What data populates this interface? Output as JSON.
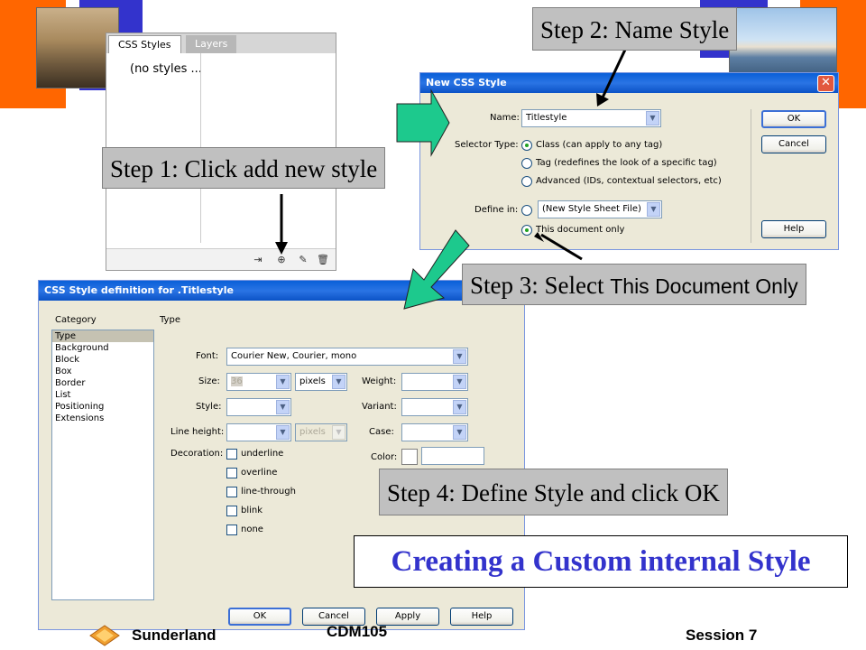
{
  "callouts": {
    "step1": "Step 1: Click add new style",
    "step2": "Step 2: Name Style",
    "step3_main": "Step 3: Select ",
    "step3_tail": "This Document Only",
    "step4": "Step 4: Define Style and click OK"
  },
  "banner": "Creating a Custom internal Style",
  "footer": {
    "left": "Sunderland",
    "center": "CDM105",
    "right": "Session 7"
  },
  "css_panel": {
    "tabs": [
      "CSS Styles",
      "Layers"
    ],
    "empty_text": "(no styles ...",
    "toolbar_icons": [
      "attach-style-sheet-icon",
      "new-css-style-icon",
      "edit-style-sheet-icon",
      "trash-icon"
    ]
  },
  "new_style_dialog": {
    "title": "New CSS Style",
    "name_label": "Name:",
    "name_value": "Titlestyle",
    "selector_label": "Selector Type:",
    "selector_options": [
      "Class (can apply to any tag)",
      "Tag (redefines the look of a specific tag)",
      "Advanced (IDs, contextual selectors, etc)"
    ],
    "define_label": "Define in:",
    "define_file": "(New Style Sheet File)",
    "define_this_doc": "This document only",
    "buttons": {
      "ok": "OK",
      "cancel": "Cancel",
      "help": "Help"
    }
  },
  "definition_dialog": {
    "title": "CSS Style definition for .Titlestyle",
    "category_label": "Category",
    "panel_label": "Type",
    "categories": [
      "Type",
      "Background",
      "Block",
      "Box",
      "Border",
      "List",
      "Positioning",
      "Extensions"
    ],
    "font_label": "Font:",
    "font_value": "Courier New, Courier, mono",
    "size_label": "Size:",
    "size_value": "36",
    "size_unit": "pixels",
    "weight_label": "Weight:",
    "style_label": "Style:",
    "variant_label": "Variant:",
    "line_height_label": "Line height:",
    "line_height_unit": "pixels",
    "case_label": "Case:",
    "decoration_label": "Decoration:",
    "decorations": [
      "underline",
      "overline",
      "line-through",
      "blink",
      "none"
    ],
    "color_label": "Color:",
    "buttons": {
      "ok": "OK",
      "cancel": "Cancel",
      "apply": "Apply",
      "help": "Help"
    }
  },
  "colors": {
    "callout_bg": "#c0c0c0",
    "banner_text": "#3333cc",
    "accent_orange": "#ff6600",
    "accent_blue": "#3333cc",
    "arrow_green": "#1dc98d"
  }
}
